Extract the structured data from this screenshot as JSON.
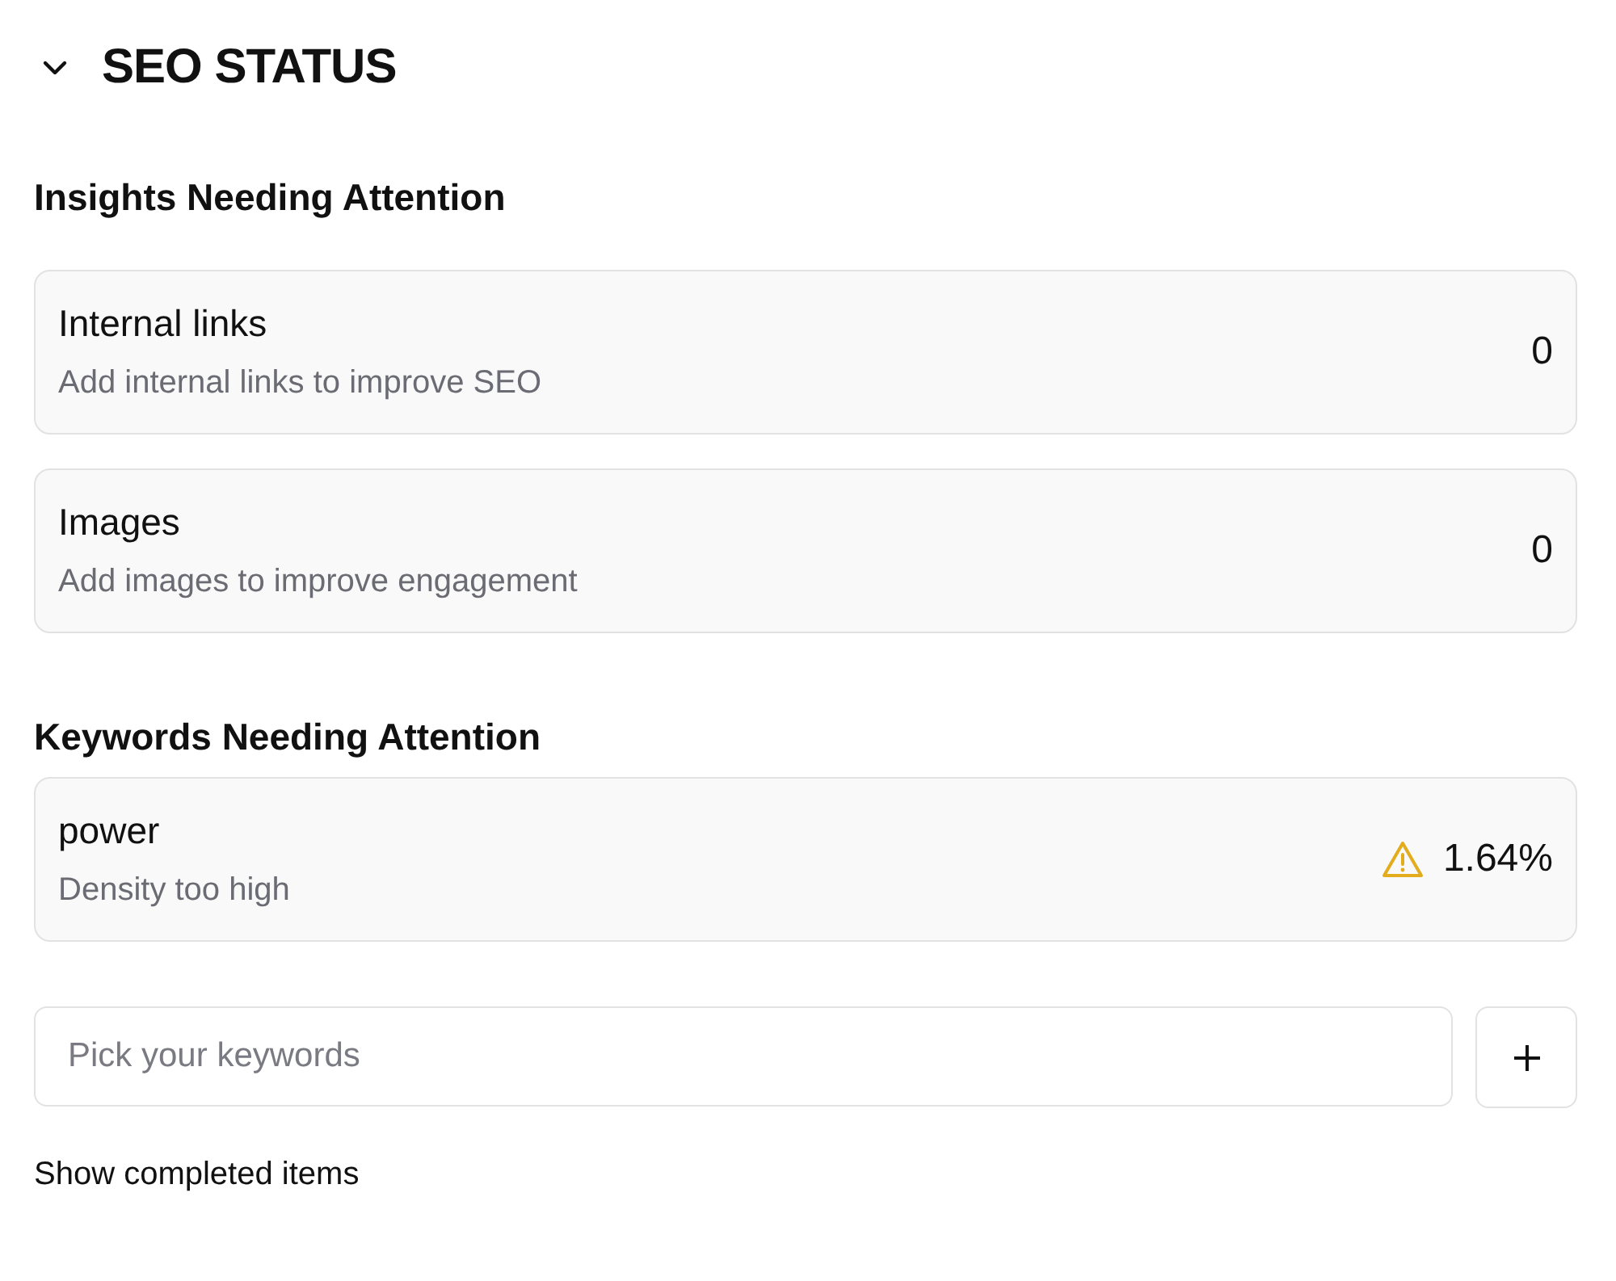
{
  "section": {
    "title": "SEO STATUS",
    "expanded": true
  },
  "insights": {
    "heading": "Insights Needing Attention",
    "items": [
      {
        "title": "Internal links",
        "description": "Add internal links to improve SEO",
        "value": "0"
      },
      {
        "title": "Images",
        "description": "Add images to improve engagement",
        "value": "0"
      }
    ]
  },
  "keywords": {
    "heading": "Keywords Needing Attention",
    "items": [
      {
        "title": "power",
        "description": "Density too high",
        "value": "1.64%",
        "kind": "warning"
      }
    ]
  },
  "keyword_input": {
    "placeholder": "Pick your keywords"
  },
  "show_completed": {
    "label": "Show completed items"
  }
}
